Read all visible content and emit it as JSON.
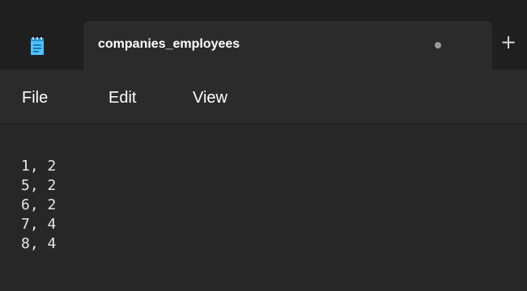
{
  "tab": {
    "title": "companies_employees",
    "unsaved_indicator": "●",
    "new_tab_label": "+"
  },
  "app_icon": "notepad-icon",
  "menu": {
    "file": "File",
    "edit": "Edit",
    "view": "View"
  },
  "editor": {
    "lines": [
      "1, 2",
      "5, 2",
      "6, 2",
      "7, 4",
      "8, 4"
    ]
  },
  "colors": {
    "titlebar_bg": "#1f1f1f",
    "tab_bg": "#2b2b2b",
    "editor_bg": "#272727",
    "text": "#e6e6e6",
    "icon_accent": "#4cc2ff"
  }
}
